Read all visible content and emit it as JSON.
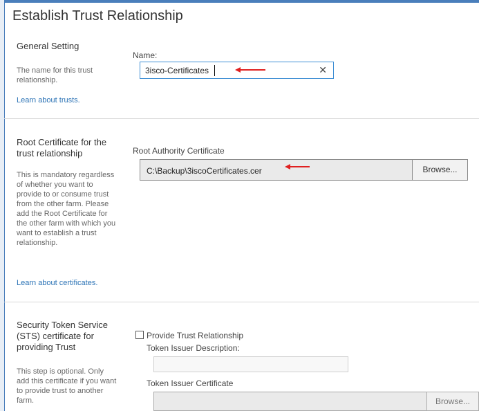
{
  "dialog": {
    "title": "Establish Trust Relationship"
  },
  "general": {
    "heading": "General Setting",
    "description": "The name for this trust relationship.",
    "link": "Learn about trusts.",
    "name_label": "Name:",
    "name_value": "3isco-Certificates",
    "clear_glyph": "✕"
  },
  "root_cert": {
    "heading": "Root Certificate for the trust relationship",
    "description": "This is mandatory regardless of whether you want to provide to or consume trust from the other farm. Please add the Root Certificate for the other farm with which you want to establish a trust relationship.",
    "link": "Learn about certificates.",
    "field_label": "Root Authority Certificate",
    "path_value": "C:\\Backup\\3iscoCertificates.cer",
    "browse_label": "Browse..."
  },
  "sts": {
    "heading": "Security Token Service (STS) certificate for providing Trust",
    "description": "This step is optional. Only add this certificate if you want to provide trust to another farm.",
    "checkbox_label": "Provide Trust Relationship",
    "checked": false,
    "issuer_desc_label": "Token Issuer Description:",
    "issuer_desc_value": "",
    "issuer_cert_label": "Token Issuer Certificate",
    "issuer_cert_value": "",
    "browse_label": "Browse..."
  },
  "colors": {
    "accent": "#3d8ed4",
    "link": "#2a72b5",
    "annotation_arrow": "#e02020"
  }
}
